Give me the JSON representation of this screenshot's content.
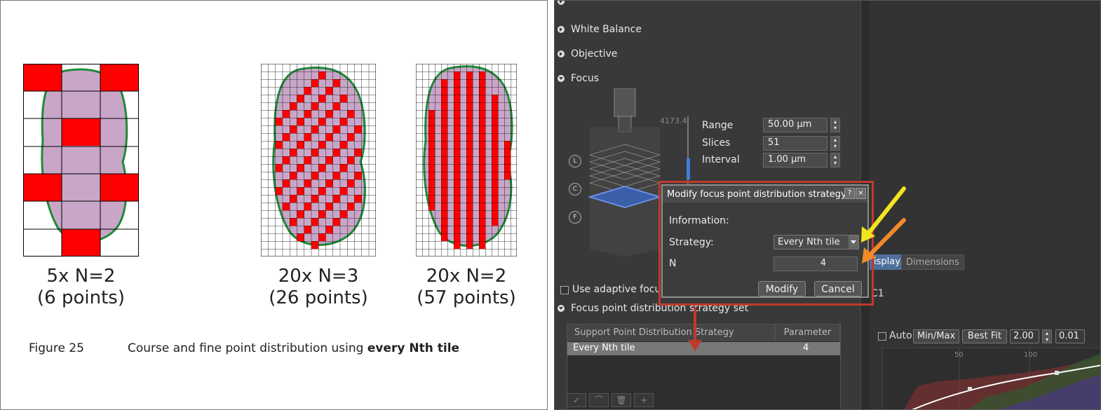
{
  "figure": {
    "panels": [
      {
        "caption_line1": "5x N=2",
        "caption_line2": "(6 points)"
      },
      {
        "caption_line1": "20x N=3",
        "caption_line2": "(26 points)"
      },
      {
        "caption_line1": "20x N=2",
        "caption_line2": "(57 points)"
      }
    ],
    "note_number": "Figure 25",
    "note_text": "Course and fine point distribution using ",
    "note_bold": "every Nth tile"
  },
  "sidebar": {
    "sections": [
      {
        "label": "White Balance",
        "expanded": false
      },
      {
        "label": "Objective",
        "expanded": false
      },
      {
        "label": "Focus",
        "expanded": true
      }
    ],
    "z_value": "4173.4",
    "focus": {
      "range_label": "Range",
      "range_value": "50.00 µm",
      "slices_label": "Slices",
      "slices_value": "51",
      "interval_label": "Interval",
      "interval_value": "1.00 µm"
    },
    "lcf_buttons": [
      "L",
      "C",
      "F"
    ],
    "adaptive_label": "Use adaptive focus p",
    "strategy_set_label": "Focus point distribution strategy set",
    "table": {
      "headers": [
        "Support Point Distribution Strategy",
        "Parameter"
      ],
      "row": {
        "strategy": "Every Nth tile",
        "parameter": "4"
      }
    },
    "toolbar_icons": [
      "✓",
      "⌒",
      "🗑",
      "+"
    ]
  },
  "dialog": {
    "title": "Modify focus point distribution strategy",
    "help": "?",
    "close": "×",
    "information_label": "Information:",
    "strategy_label": "Strategy:",
    "strategy_value": "Every Nth tile",
    "n_label": "N",
    "n_value": "4",
    "modify": "Modify",
    "cancel": "Cancel"
  },
  "view": {
    "tabs": [
      "isplay",
      "Dimensions"
    ],
    "channel": "C1",
    "auto_label": "Auto",
    "minmax": "Min/Max",
    "bestfit": "Best Fit",
    "gamma": "2.00",
    "value2": "0.01",
    "hist_ticks": [
      "50",
      "100"
    ]
  },
  "colors": {
    "tissue": "#c9a6c8",
    "outline": "#1f8a3a",
    "marker": "#ff0000",
    "highlight": "#c03a2b",
    "arrow_yellow": "#f2e41f",
    "arrow_orange": "#f28a2a"
  }
}
